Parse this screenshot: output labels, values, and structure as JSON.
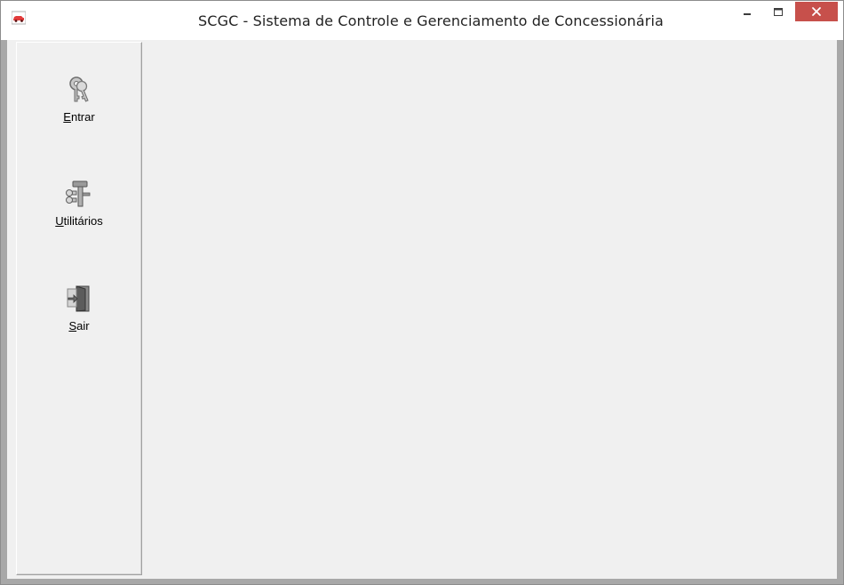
{
  "window": {
    "title": "SCGC - Sistema de Controle e Gerenciamento de Concessionária",
    "app_icon": "car-icon",
    "controls": {
      "minimize_icon": "minimize-icon",
      "maximize_icon": "maximize-icon",
      "close_icon": "close-icon",
      "close_color": "#c7504b"
    }
  },
  "sidebar": {
    "items": [
      {
        "label_mnemonic": "E",
        "label_rest": "ntrar",
        "icon": "keys-icon"
      },
      {
        "label_mnemonic": "U",
        "label_rest": "tilitários",
        "icon": "tools-icon"
      },
      {
        "label_mnemonic": "S",
        "label_rest": "air",
        "icon": "exit-door-icon"
      }
    ]
  },
  "colors": {
    "client_background": "#f0f0f0",
    "window_frame": "#a8a8a8",
    "titlebar": "#ffffff"
  }
}
